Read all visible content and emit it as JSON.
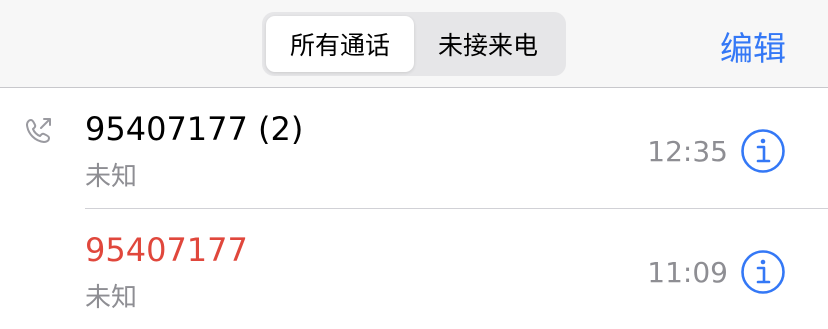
{
  "header": {
    "segments": [
      "所有通话",
      "未接来电"
    ],
    "active_segment": 0,
    "edit_label": "编辑"
  },
  "calls": [
    {
      "number": "95407177 (2)",
      "label": "未知",
      "time": "12:35",
      "missed": false,
      "icon": "outgoing-call-icon"
    },
    {
      "number": "95407177",
      "label": "未知",
      "time": "11:09",
      "missed": true,
      "icon": ""
    }
  ],
  "colors": {
    "accent": "#3478f6",
    "missed": "#e0473c",
    "secondary": "#8e8e93"
  }
}
